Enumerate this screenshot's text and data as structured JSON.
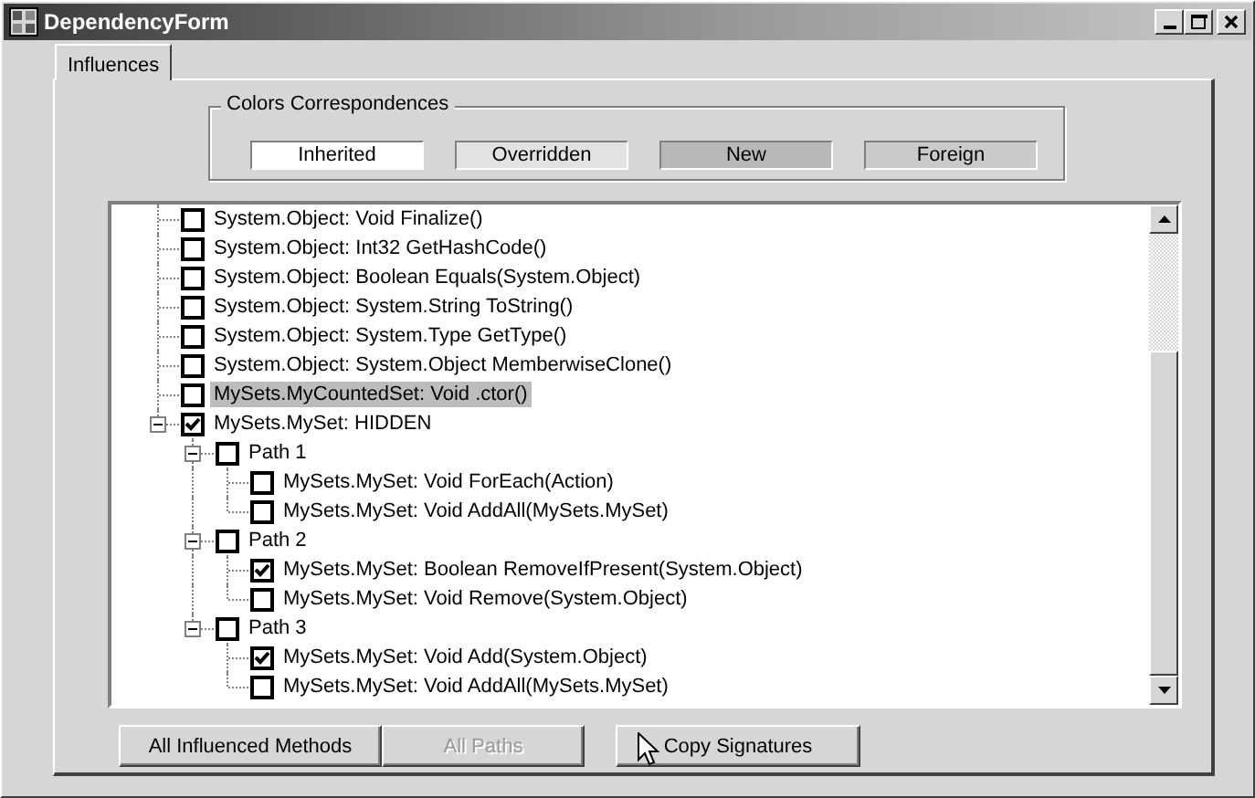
{
  "window": {
    "title": "DependencyForm"
  },
  "tabs": [
    {
      "label": "Influences",
      "selected": true
    }
  ],
  "legend": {
    "title": "Colors Correspondences",
    "items": [
      {
        "label": "Inherited",
        "color": "#ffffff"
      },
      {
        "label": "Overridden",
        "color": "#e2e2e2"
      },
      {
        "label": "New",
        "color": "#b8b8b8"
      },
      {
        "label": "Foreign",
        "color": "#cacaca"
      }
    ]
  },
  "tree": {
    "items": [
      {
        "label": "System.Object: Void Finalize()",
        "checked": false,
        "selected": false
      },
      {
        "label": "System.Object: Int32 GetHashCode()",
        "checked": false,
        "selected": false
      },
      {
        "label": "System.Object: Boolean Equals(System.Object)",
        "checked": false,
        "selected": false
      },
      {
        "label": "System.Object: System.String ToString()",
        "checked": false,
        "selected": false
      },
      {
        "label": "System.Object: System.Type GetType()",
        "checked": false,
        "selected": false
      },
      {
        "label": "System.Object: System.Object MemberwiseClone()",
        "checked": false,
        "selected": false
      },
      {
        "label": "MySets.MyCountedSet: Void .ctor()",
        "checked": false,
        "selected": true
      },
      {
        "label": "MySets.MySet: HIDDEN",
        "checked": true,
        "selected": false,
        "expanded": true,
        "children": [
          {
            "label": "Path 1",
            "checked": false,
            "selected": false,
            "expanded": true,
            "children": [
              {
                "label": "MySets.MySet: Void ForEach(Action)",
                "checked": false,
                "selected": false
              },
              {
                "label": "MySets.MySet: Void AddAll(MySets.MySet)",
                "checked": false,
                "selected": false
              }
            ]
          },
          {
            "label": "Path 2",
            "checked": false,
            "selected": false,
            "expanded": true,
            "children": [
              {
                "label": "MySets.MySet: Boolean RemoveIfPresent(System.Object)",
                "checked": true,
                "selected": false
              },
              {
                "label": "MySets.MySet: Void Remove(System.Object)",
                "checked": false,
                "selected": false
              }
            ]
          },
          {
            "label": "Path 3",
            "checked": false,
            "selected": false,
            "expanded": true,
            "children": [
              {
                "label": "MySets.MySet: Void Add(System.Object)",
                "checked": true,
                "selected": false
              },
              {
                "label": "MySets.MySet: Void AddAll(MySets.MySet)",
                "checked": false,
                "selected": false
              }
            ]
          }
        ]
      }
    ]
  },
  "buttons": [
    {
      "label": "All Influenced Methods",
      "disabled": false
    },
    {
      "label": "All Paths",
      "disabled": true
    },
    {
      "label": "Copy Signatures",
      "disabled": false
    }
  ]
}
